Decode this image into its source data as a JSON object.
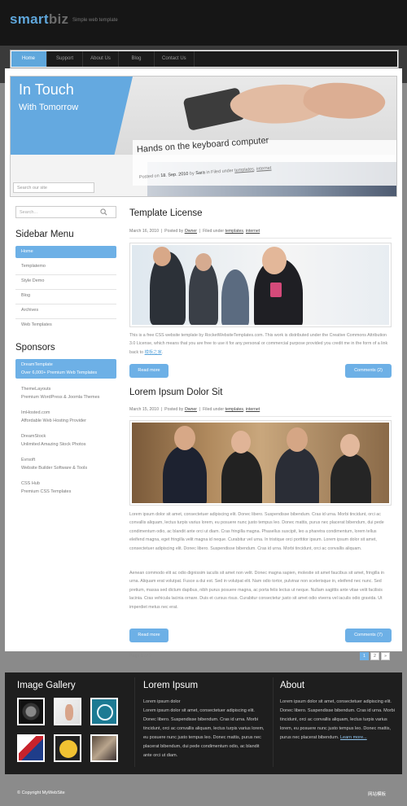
{
  "header": {
    "logo_smart": "smart",
    "logo_biz": "biz",
    "tagline": "Simple web template"
  },
  "nav": {
    "items": [
      "Home",
      "Support",
      "About Us",
      "Blog",
      "Contact Us"
    ],
    "active_index": 0
  },
  "banner": {
    "title": "In Touch",
    "subtitle": "With Tomorrow",
    "caption_title": "Hands on the keyboard computer",
    "caption_meta_prefix": "Posted on",
    "caption_date": "18. Sep. 2010",
    "caption_by": "by",
    "caption_author": "Sara",
    "caption_filed": "in Filed under",
    "caption_cat1": "templates",
    "caption_cat2": "internet",
    "search_placeholder": "Search our site"
  },
  "sidebar": {
    "search_placeholder": "Search...",
    "menu_heading": "Sidebar Menu",
    "menu_items": [
      "Home",
      "Templatemo",
      "Style Demo",
      "Blog",
      "Archives",
      "Web Templates"
    ],
    "sponsors_heading": "Sponsors",
    "sponsors": [
      {
        "name": "DreamTemplate",
        "desc": "Over 6,000+ Premium Web Templates"
      },
      {
        "name": "ThemeLayouts",
        "desc": "Premium WordPress & Joomla Themes"
      },
      {
        "name": "ImHosted.com",
        "desc": "Affordable Web Hosting Provider"
      },
      {
        "name": "DreamStock",
        "desc": "Unlimited Amazing Stock Photos"
      },
      {
        "name": "Evrsoft",
        "desc": "Website Builder Software & Tools"
      },
      {
        "name": "CSS Hub",
        "desc": "Premium CSS Templates"
      }
    ]
  },
  "posts": [
    {
      "title": "Template License",
      "date": "March 16, 2010",
      "posted_by": "Posted by",
      "author": "Owner",
      "filed": "Filed under",
      "cat1": "templates",
      "cat2": "internet",
      "body_1": "This is a free CSS website template by RocketWebsiteTemplates.com. This work is distributed under the Creative Commons Attribution 3.0 License, which means that you are free to use it for any personal or commercial purpose provided you credit me in the form of a link back to",
      "link": "模板之家",
      "read_more": "Read more",
      "comments": "Comments (2)"
    },
    {
      "title": "Lorem Ipsum Dolor Sit",
      "date": "March 15, 2010",
      "posted_by": "Posted by",
      "author": "Owner",
      "filed": "Filed under",
      "cat1": "templates",
      "cat2": "internet",
      "body_1": "Lorem ipsum dolor sit amet, consectetuer adipiscing elit. Donec libero. Suspendisse bibendum. Cras id urna. Morbi tincidunt, orci ac convallis aliquam, lectus turpis varius lorem, eu posuere nunc justo tempus leo. Donec mattis, purus nec placerat bibendum, dui pede condimentum odio, ac blandit ante orci ut diam. Cras fringilla magna. Phasellus suscipit, leo a pharetra condimentum, lorem tellus eleifend magna, eget fringilla velit magna id neque. Curabitur vel urna. In tristique orci porttitor ipsum. Lorem ipsum dolor sit amet, consectetuer adipiscing elit. Donec libero. Suspendisse bibendum. Cras id urna. Morbi tincidunt, orci ac convallis aliquam.",
      "body_2": "Aenean commodo elit ac odio dignissim iaculis sit amet non velit. Donec magna sapien, molestie sit amet faucibus sit amet, fringilla in urna. Aliquam erat volutpat. Fusce a dui est. Sed in volutpat elit. Nam odio tortor, pulvinar non scelerisque in, eleifend nec nunc. Sed pretium, massa sed dictum dapibus, nibh purus posuere magna, ac porta felis lectus ut neque. Nullam sagittis ante vitae velit facilisis lacinia. Cras vehicula lacinia ornare. Duis et cursus risus. Curabitur consectetur justo sit amet odio viverra vel iaculis odio gravida. Ut imperdiet metus nec erat.",
      "read_more": "Read more",
      "comments": "Comments (7)"
    }
  ],
  "pagination": {
    "text": "Page 1 of 2",
    "pages": [
      "1",
      "2",
      "»"
    ],
    "active_index": 0
  },
  "footer": {
    "gallery_heading": "Image Gallery",
    "lorem_heading": "Lorem Ipsum",
    "lorem_line1": "Lorem ipsum dolor",
    "lorem_text": "Lorem ipsum dolor sit amet, consectetuer adipiscing elit. Donec libero. Suspendisse bibendum. Cras id urna. Morbi tincidunt, orci ac convallis aliquam, lectus turpis varius lorem, eu posuere nunc justo tempus leo. Donec mattis, purus nec placerat bibendum, dui pede condimentum odio, ac blandit ante orci ut diam.",
    "about_heading": "About",
    "about_text": "Lorem ipsum dolor sit amet, consectetuer adipiscing elit. Donec libero. Suspendisse bibendum. Cras id urna. Morbi tincidunt, orci ac convallis aliquam, lectus turpis varius lorem, eu posuere nunc justo tempus leo. Donec mattis, purus nec placerat bibendum.",
    "learn_more": "Learn more...",
    "copyright": "© Copyright MyWebSite",
    "credit": "网站模板"
  },
  "colors": {
    "accent": "#6db0e6",
    "header_bg": "#161616",
    "footer_bg": "#1e1e1e"
  }
}
